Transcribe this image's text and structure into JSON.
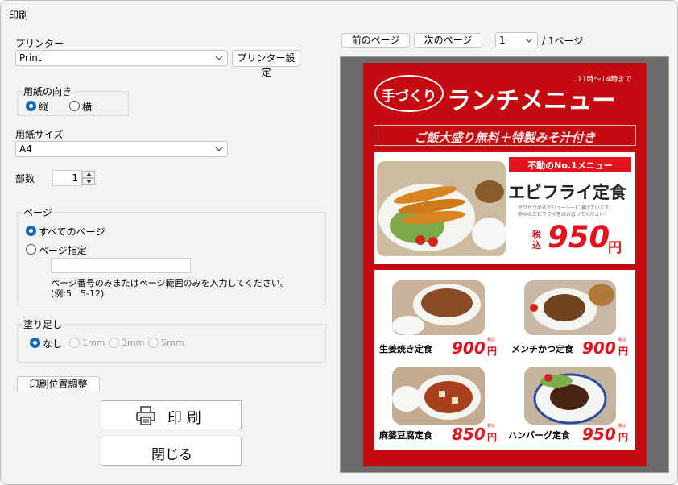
{
  "window": {
    "title": "印刷"
  },
  "printer": {
    "label": "プリンター",
    "value": "Print",
    "settings_button": "プリンター設定"
  },
  "orientation": {
    "legend": "用紙の向き",
    "options": [
      {
        "label": "縦",
        "selected": true
      },
      {
        "label": "横",
        "selected": false
      }
    ]
  },
  "paper_size": {
    "label": "用紙サイズ",
    "value": "A4"
  },
  "copies": {
    "label": "部数",
    "value": "1"
  },
  "page_group": {
    "legend": "ページ",
    "all_pages": "すべてのページ",
    "specify": "ページ指定",
    "range_value": "",
    "hint_line1": "ページ番号のみまたはページ範囲のみを入力してください。",
    "hint_line2": "(例:5　5-12)"
  },
  "bleed": {
    "legend": "塗り足し",
    "options": [
      {
        "label": "なし",
        "selected": true
      },
      {
        "label": "1mm",
        "selected": false
      },
      {
        "label": "3mm",
        "selected": false
      },
      {
        "label": "5mm",
        "selected": false
      }
    ]
  },
  "position_button": "印刷位置調整",
  "print_button": "印 刷",
  "close_button": "閉じる",
  "nav": {
    "prev_page": "前のページ",
    "next_page": "次のページ",
    "page_value": "1",
    "page_total": "/ 1ページ"
  },
  "poster": {
    "hours": "11時～14時まで",
    "badge": "手づくり",
    "title": "ランチメニュー",
    "banner": "ご飯大盛り無料＋特製みそ汁付き",
    "featured": {
      "tag": "不動のNo.1メニュー",
      "name": "エビフライ定食",
      "desc_line1": "サクサクの衣でジューシーに揚げています。",
      "desc_line2": "熱々のエビフライをほおばってください！",
      "tax": "税込",
      "price": "950",
      "yen": "円"
    },
    "items": [
      {
        "name": "生姜焼き定食",
        "price": "900",
        "yen": "円",
        "tax": "税込"
      },
      {
        "name": "メンチかつ定食",
        "price": "900",
        "yen": "円",
        "tax": "税込"
      },
      {
        "name": "麻婆豆腐定食",
        "price": "850",
        "yen": "円",
        "tax": "税込"
      },
      {
        "name": "ハンバーグ定食",
        "price": "950",
        "yen": "円",
        "tax": "税込"
      }
    ]
  },
  "colors": {
    "accent": "#0f6cbd",
    "poster_red": "#c40b12",
    "preview_bg": "#6b6b6b"
  }
}
